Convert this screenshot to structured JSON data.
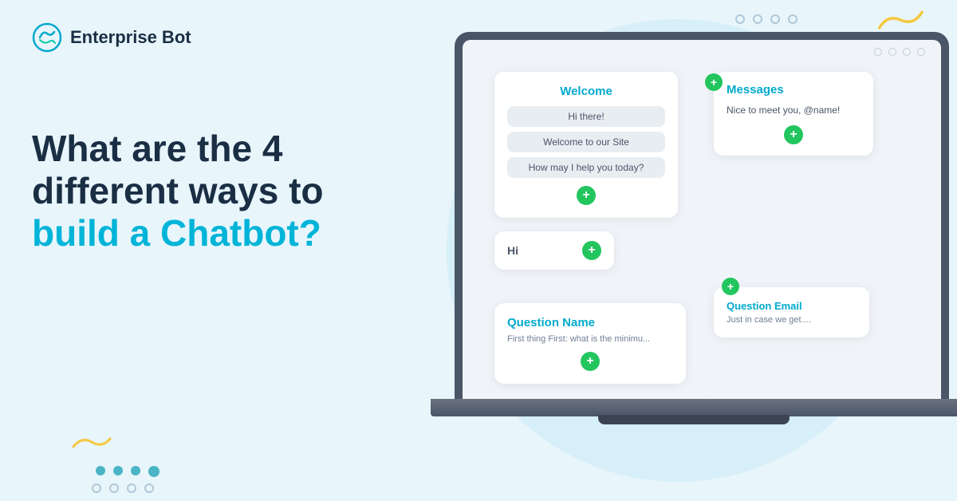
{
  "brand": {
    "name": "Enterprise Bot",
    "logo_alt": "Enterprise Bot Logo"
  },
  "headline": {
    "line1": "What are the 4",
    "line2": "different ways to",
    "line3_plain": "",
    "line3_blue": "build a Chatbot?"
  },
  "laptop": {
    "window_dots": [
      "",
      "",
      "",
      ""
    ],
    "welcome_card": {
      "title": "Welcome",
      "messages": [
        "Hi there!",
        "Welcome to our Site",
        "How may I help you today?"
      ],
      "add_label": "+"
    },
    "messages_card": {
      "title": "Messages",
      "body": "Nice to meet you, @name!",
      "add_label": "+"
    },
    "hi_card": {
      "text": "Hi",
      "add_label": "+"
    },
    "qname_card": {
      "title": "Question Name",
      "sub": "First thing First: what is the minimu...",
      "add_label": "+"
    },
    "qemail_card": {
      "title": "Question Email",
      "sub": "Just in case we get....",
      "add_label": "+"
    }
  },
  "deco": {
    "wave_symbol": "〜",
    "filled_dots": [
      "",
      "",
      "",
      ""
    ],
    "circle_dots": [
      "",
      "",
      "",
      ""
    ]
  }
}
